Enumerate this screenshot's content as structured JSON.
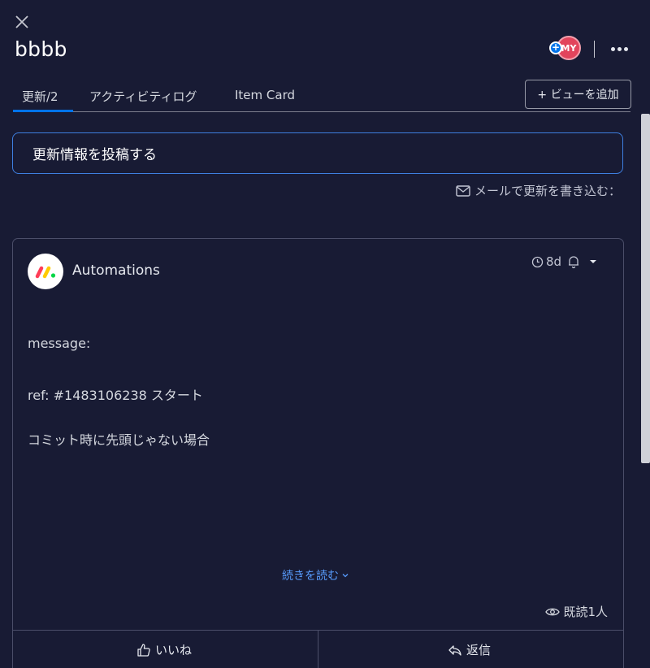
{
  "header": {
    "title": "bbbb",
    "avatar_initials": "MY",
    "avatar_color": "#e2445c"
  },
  "tabs": [
    {
      "label": "更新/2",
      "active": true
    },
    {
      "label": "アクティビティログ",
      "active": false
    },
    {
      "label": "Item Card",
      "active": false
    }
  ],
  "add_view_label": "+ ビューを追加",
  "composer": {
    "placeholder": "更新情報を投稿する"
  },
  "email_link": "メールで更新を書き込む：",
  "post": {
    "author": "Automations",
    "time": "8d",
    "lines": [
      "message:",
      "ref: #1483106238 スタート",
      "コミット時に先頭じゃない場合"
    ],
    "read_more": "続きを読む",
    "seen": "既読1人"
  },
  "actions": {
    "like": "いいね",
    "reply": "返信"
  },
  "colors": {
    "background": "#181b34",
    "accent": "#0073ea",
    "link": "#579bfc"
  },
  "icons": {
    "close": "close-icon",
    "more": "more-icon",
    "envelope": "envelope-icon",
    "clock": "clock-icon",
    "bell": "bell-icon",
    "caret": "caret-down-icon",
    "eye": "eye-icon",
    "like": "thumbs-up-icon",
    "reply": "reply-icon"
  }
}
